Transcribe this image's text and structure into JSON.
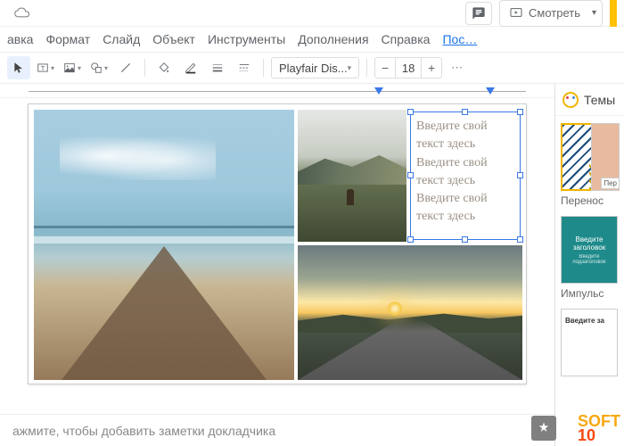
{
  "header": {
    "present_label": "Смотреть"
  },
  "menu": {
    "vstavka": "авка",
    "format": "Формат",
    "slide": "Слайд",
    "object": "Объект",
    "tools": "Инструменты",
    "addons": "Дополнения",
    "help": "Справка",
    "last_link": "Пос…"
  },
  "toolbar": {
    "font_name": "Playfair Dis...",
    "font_size": "18",
    "minus": "−",
    "plus": "+",
    "more": "⋯"
  },
  "textbox": {
    "l1": "Введите свой",
    "l2": "текст здесь",
    "l3": "Введите свой",
    "l4": "текст здесь",
    "l5": "Введите свой",
    "l6": "текст здесь"
  },
  "notes": {
    "placeholder": "ажмите, чтобы добавить заметки докладчика"
  },
  "themes": {
    "title": "Темы",
    "t1": "Перенос",
    "t1_btn": "Пер",
    "t2": "Импульс",
    "t2_thumb_title": "Введите заголовок",
    "t2_thumb_sub": "Введите подзаголовок",
    "t3_thumb": "Введите за"
  },
  "watermark": {
    "l1": "SOFT",
    "l2": "10"
  }
}
